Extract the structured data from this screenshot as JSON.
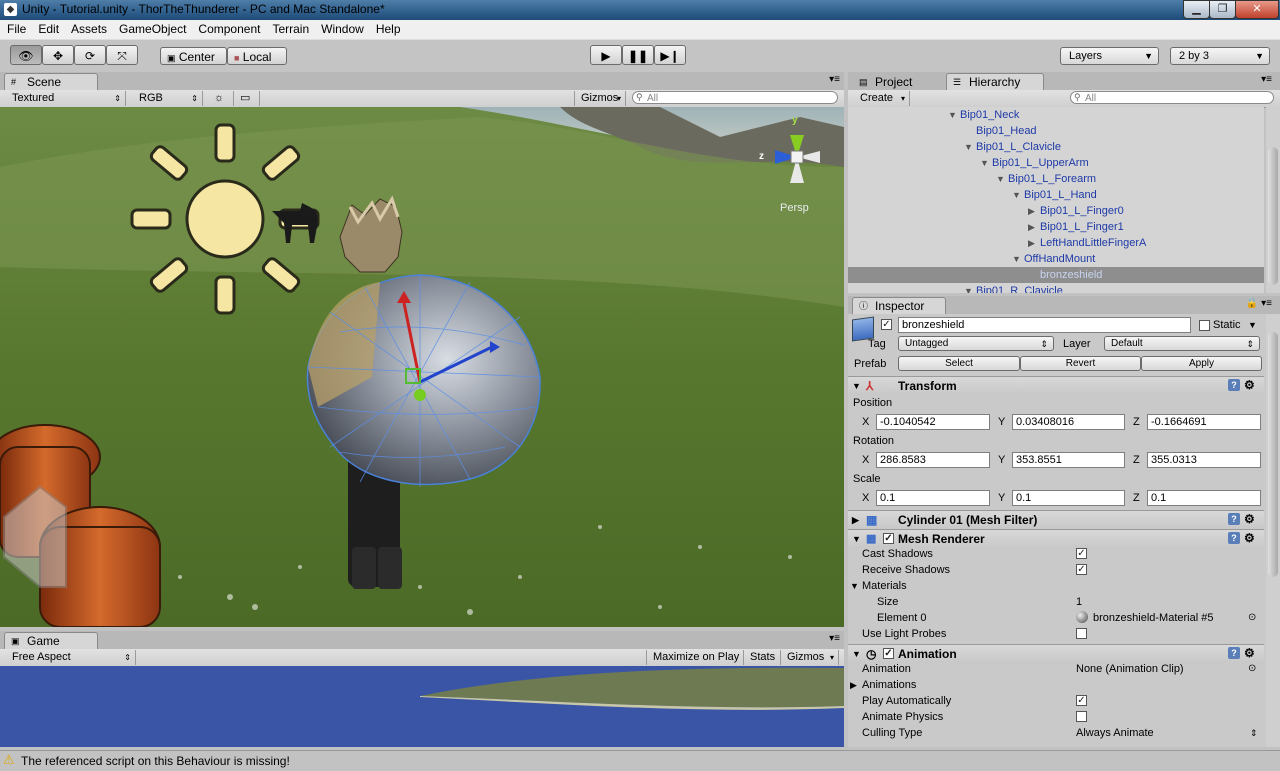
{
  "window": {
    "title": "Unity - Tutorial.unity - ThorTheThunderer - PC and Mac Standalone*"
  },
  "menu": [
    "File",
    "Edit",
    "Assets",
    "GameObject",
    "Component",
    "Terrain",
    "Window",
    "Help"
  ],
  "toolbar": {
    "pivot_label": "Center",
    "space_label": "Local",
    "layers_label": "Layers",
    "layout_label": "2 by 3"
  },
  "scene": {
    "tab_label": "Scene",
    "render_mode": "Textured",
    "color_mode": "RGB",
    "gizmos_label": "Gizmos",
    "search_placeholder": "All",
    "persp_label": "Persp",
    "axis_y": "y",
    "axis_z": "z"
  },
  "game": {
    "tab_label": "Game",
    "aspect": "Free Aspect",
    "maximize_label": "Maximize on Play",
    "stats_label": "Stats",
    "gizmos_label": "Gizmos"
  },
  "project_tab": "Project",
  "hierarchy": {
    "tab_label": "Hierarchy",
    "create_label": "Create",
    "search_placeholder": "All",
    "rows": [
      {
        "label": "Bip01_Neck",
        "depth": 6,
        "arrow": "▼"
      },
      {
        "label": "Bip01_Head",
        "depth": 7,
        "arrow": ""
      },
      {
        "label": "Bip01_L_Clavicle",
        "depth": 7,
        "arrow": "▼"
      },
      {
        "label": "Bip01_L_UpperArm",
        "depth": 8,
        "arrow": "▼"
      },
      {
        "label": "Bip01_L_Forearm",
        "depth": 9,
        "arrow": "▼"
      },
      {
        "label": "Bip01_L_Hand",
        "depth": 10,
        "arrow": "▼"
      },
      {
        "label": "Bip01_L_Finger0",
        "depth": 11,
        "arrow": "▶"
      },
      {
        "label": "Bip01_L_Finger1",
        "depth": 11,
        "arrow": "▶"
      },
      {
        "label": "LeftHandLittleFingerA",
        "depth": 11,
        "arrow": "▶"
      },
      {
        "label": "OffHandMount",
        "depth": 10,
        "arrow": "▼"
      },
      {
        "label": "bronzeshield",
        "depth": 11,
        "arrow": "",
        "selected": true
      },
      {
        "label": "Bip01_R_Clavicle",
        "depth": 7,
        "arrow": "▼"
      }
    ]
  },
  "inspector": {
    "tab_label": "Inspector",
    "object_name": "bronzeshield",
    "static_label": "Static",
    "tag_label": "Tag",
    "tag_value": "Untagged",
    "layer_label": "Layer",
    "layer_value": "Default",
    "prefab_label": "Prefab",
    "select_label": "Select",
    "revert_label": "Revert",
    "apply_label": "Apply",
    "transform": {
      "title": "Transform",
      "position_label": "Position",
      "rotation_label": "Rotation",
      "scale_label": "Scale",
      "position": {
        "x": "-0.1040542",
        "y": "0.03408016",
        "z": "-0.1664691"
      },
      "rotation": {
        "x": "286.8583",
        "y": "353.8551",
        "z": "355.0313"
      },
      "scale": {
        "x": "0.1",
        "y": "0.1",
        "z": "0.1"
      }
    },
    "mesh_filter_title": "Cylinder 01 (Mesh Filter)",
    "mesh_renderer": {
      "title": "Mesh Renderer",
      "cast_shadows": "Cast Shadows",
      "receive_shadows": "Receive Shadows",
      "materials": "Materials",
      "size_label": "Size",
      "size_value": "1",
      "element0_label": "Element 0",
      "element0_value": "bronzeshield-Material #5",
      "use_light_probes": "Use Light Probes"
    },
    "animation": {
      "title": "Animation",
      "animation_label": "Animation",
      "animation_value": "None (Animation Clip)",
      "animations_label": "Animations",
      "play_auto": "Play Automatically",
      "animate_physics": "Animate Physics",
      "culling_label": "Culling Type",
      "culling_value": "Always Animate"
    }
  },
  "status": {
    "message": "The referenced script on this Behaviour is missing!"
  }
}
